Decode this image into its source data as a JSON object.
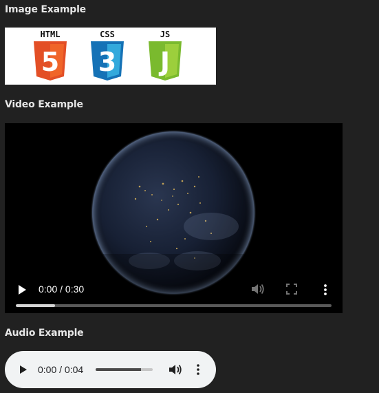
{
  "sections": {
    "image_heading": "Image Example",
    "video_heading": "Video Example",
    "audio_heading": "Audio Example"
  },
  "image_example": {
    "logos": [
      {
        "label": "HTML",
        "digit": "5",
        "color": "#e34f26",
        "shade": "#f06529",
        "icon": "html5-logo-icon"
      },
      {
        "label": "CSS",
        "digit": "3",
        "color": "#1572b6",
        "shade": "#33a9dc",
        "icon": "css3-logo-icon"
      },
      {
        "label": "JS",
        "digit": "J",
        "color": "#7aba2e",
        "shade": "#9ccf3c",
        "icon": "js-logo-icon"
      }
    ]
  },
  "video": {
    "time": "0:00 / 0:30",
    "buffered_fraction": 0.125,
    "icons": {
      "play": "play-icon",
      "volume": "volume-icon",
      "fullscreen": "fullscreen-icon",
      "more": "more-options-icon"
    }
  },
  "audio": {
    "time": "0:00 / 0:04",
    "volume_fraction": 0.8,
    "icons": {
      "play": "play-icon",
      "volume": "volume-icon",
      "more": "more-options-icon"
    }
  },
  "colors": {
    "page_background": "#212121",
    "video_background": "#000000",
    "audio_background": "#f1f3f4"
  }
}
